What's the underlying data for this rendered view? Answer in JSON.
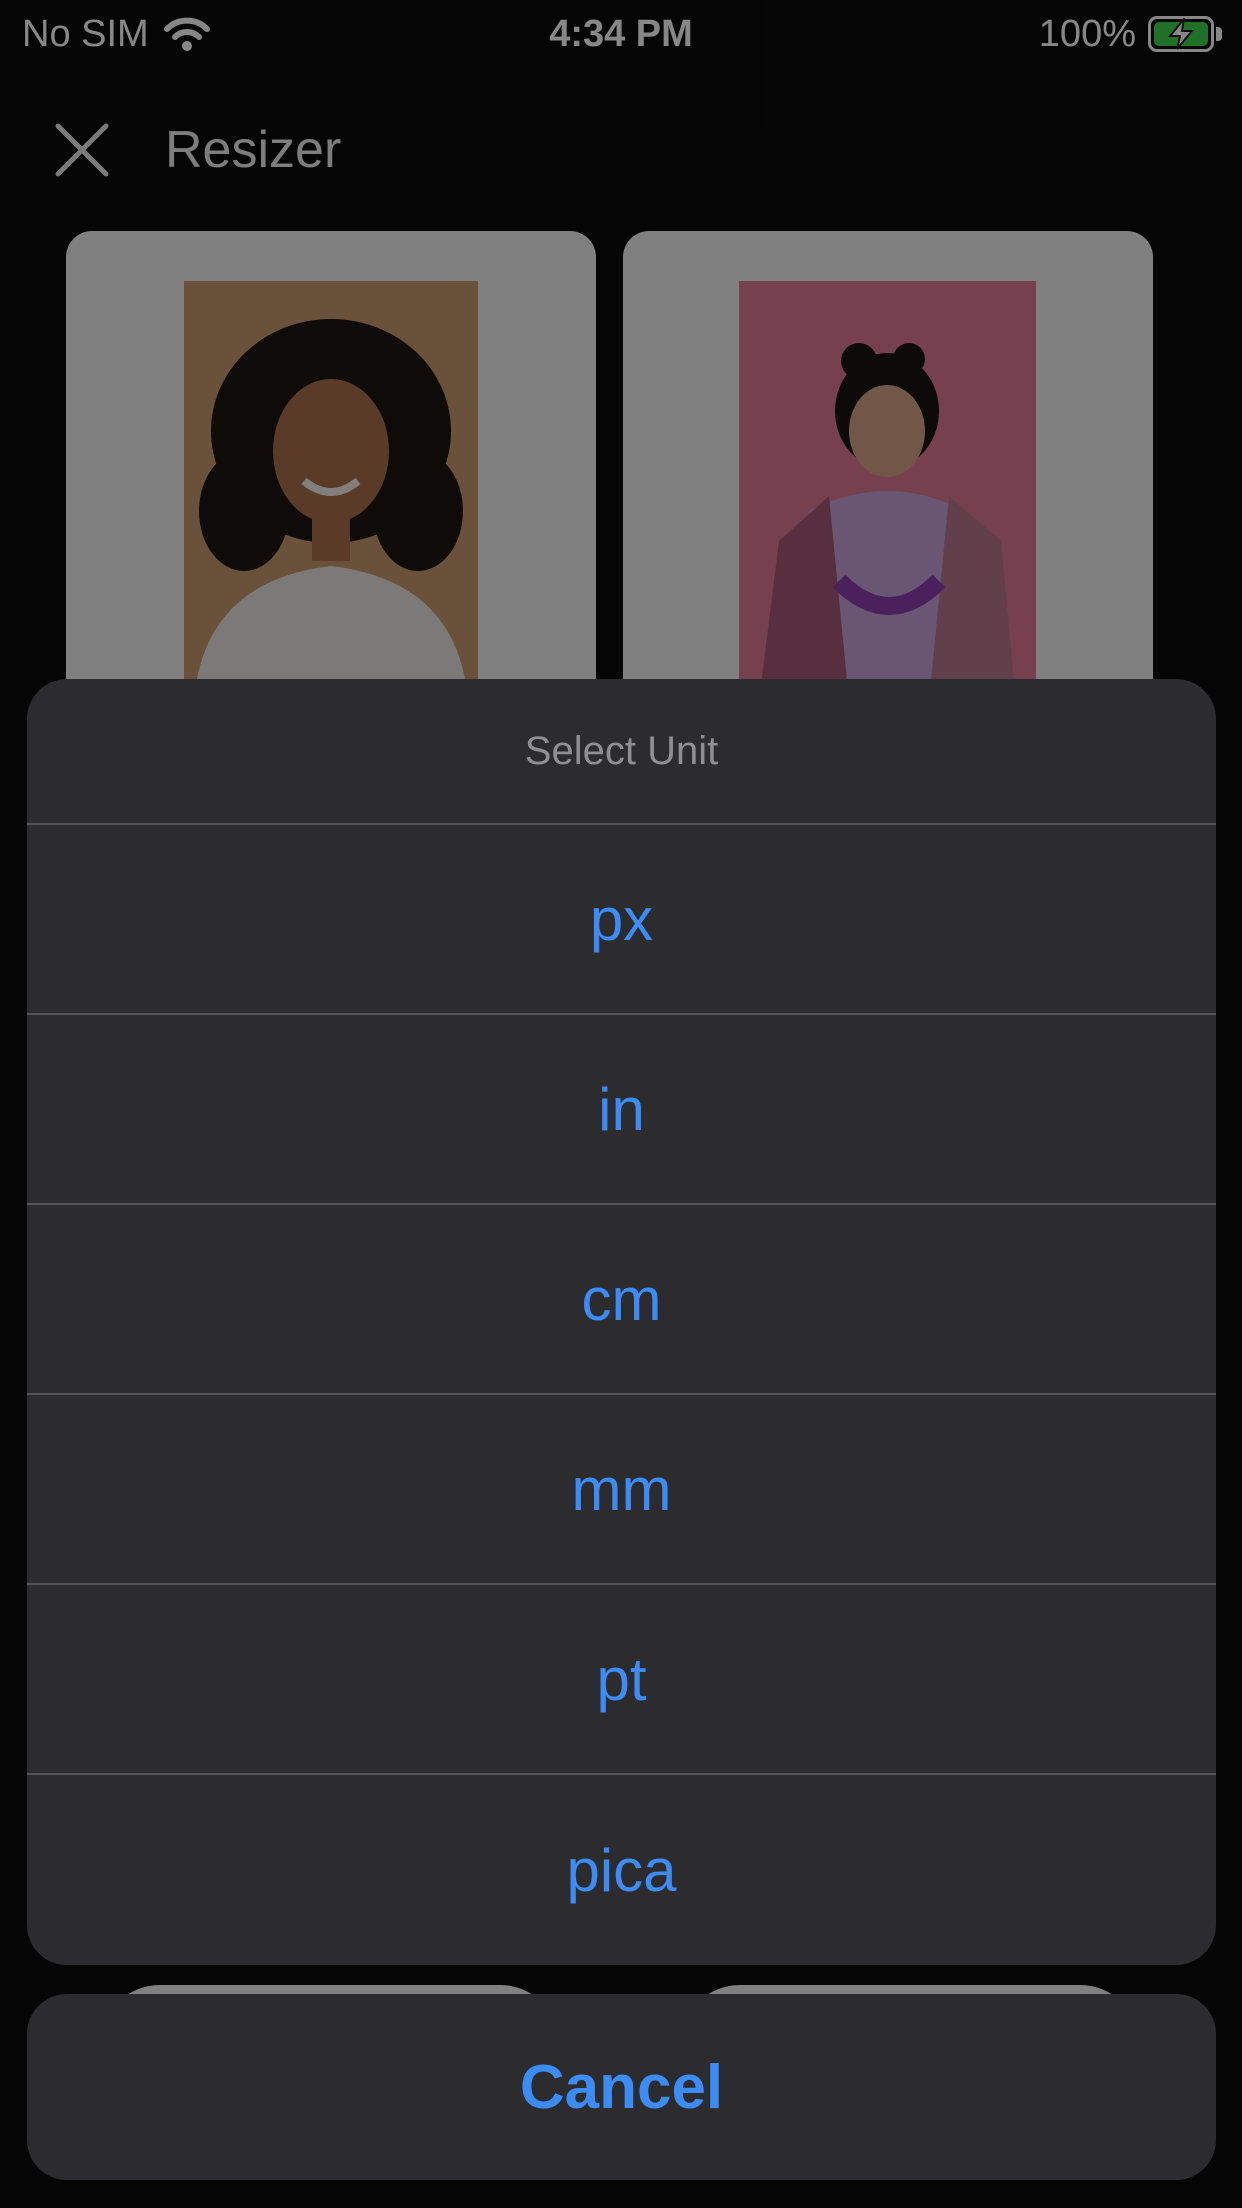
{
  "status_bar": {
    "carrier": "No SIM",
    "time": "4:34 PM",
    "battery": "100%",
    "battery_color": "#3fd34a"
  },
  "header": {
    "title": "Resizer",
    "close_icon": "close-icon"
  },
  "action_sheet": {
    "title": "Select Unit",
    "options": [
      "px",
      "in",
      "cm",
      "mm",
      "pt",
      "pica"
    ],
    "cancel_label": "Cancel",
    "accent_color": "#3b8cf7"
  }
}
